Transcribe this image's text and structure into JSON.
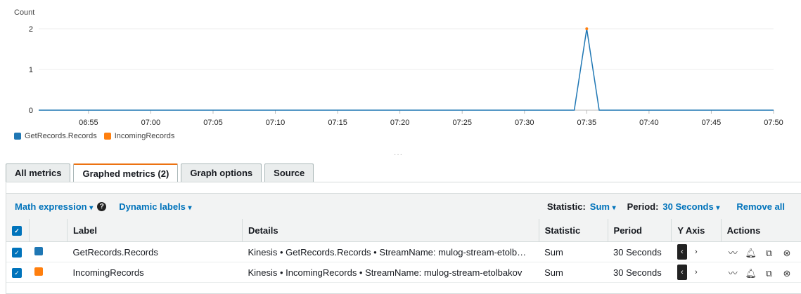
{
  "chart_data": {
    "type": "line",
    "ylabel": "Count",
    "ylim": [
      0,
      2
    ],
    "yticks": [
      0,
      1,
      2
    ],
    "xticks": [
      "06:55",
      "07:00",
      "07:05",
      "07:10",
      "07:15",
      "07:20",
      "07:25",
      "07:30",
      "07:35",
      "07:40",
      "07:45",
      "07:50"
    ],
    "xrange": [
      "06:51",
      "07:50"
    ],
    "series": [
      {
        "name": "GetRecords.Records",
        "color": "#1f77b4",
        "points": [
          [
            "06:51",
            0
          ],
          [
            "07:34",
            0
          ],
          [
            "07:35",
            2
          ],
          [
            "07:36",
            0
          ],
          [
            "07:50",
            0
          ]
        ]
      },
      {
        "name": "IncomingRecords",
        "color": "#ff7f0e",
        "points": [
          [
            "07:35",
            2
          ]
        ]
      }
    ]
  },
  "tabs": [
    {
      "label": "All metrics",
      "active": false
    },
    {
      "label": "Graphed metrics (2)",
      "active": true
    },
    {
      "label": "Graph options",
      "active": false
    },
    {
      "label": "Source",
      "active": false
    }
  ],
  "toolbar": {
    "math_expression": "Math expression",
    "dynamic_labels": "Dynamic labels",
    "statistic_label": "Statistic:",
    "statistic_value": "Sum",
    "period_label": "Period:",
    "period_value": "30 Seconds",
    "remove_all": "Remove all"
  },
  "table": {
    "headers": {
      "label": "Label",
      "details": "Details",
      "statistic": "Statistic",
      "period": "Period",
      "yaxis": "Y Axis",
      "actions": "Actions"
    },
    "rows": [
      {
        "label": "GetRecords.Records",
        "color": "#1f77b4",
        "details": "Kinesis • GetRecords.Records • StreamName: mulog-stream-etolb…",
        "statistic": "Sum",
        "period": "30 Seconds"
      },
      {
        "label": "IncomingRecords",
        "color": "#ff7f0e",
        "details": "Kinesis • IncomingRecords • StreamName: mulog-stream-etolbakov",
        "statistic": "Sum",
        "period": "30 Seconds"
      }
    ]
  }
}
